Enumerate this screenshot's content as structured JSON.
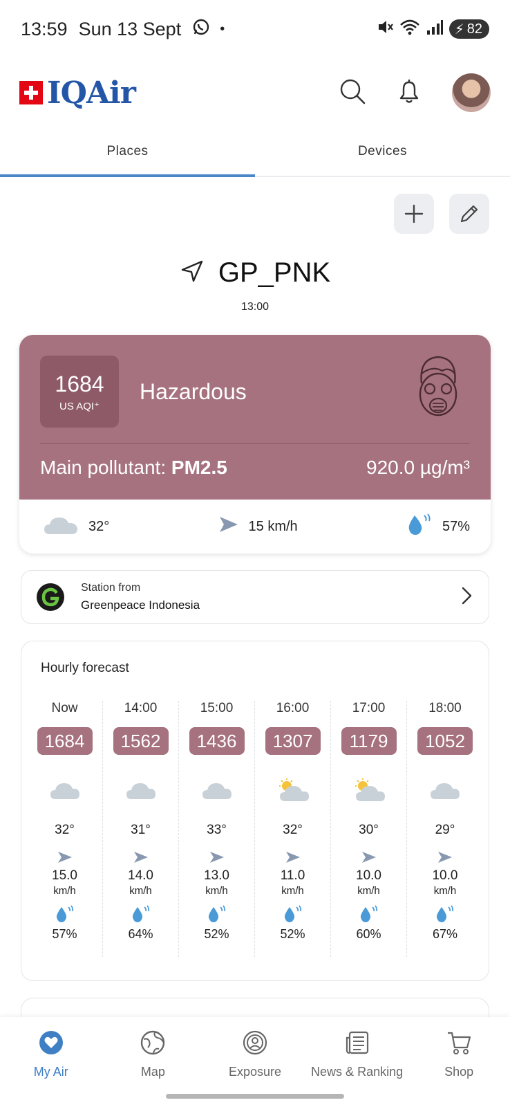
{
  "status_bar": {
    "time": "13:59",
    "date": "Sun 13 Sept",
    "battery": "82"
  },
  "header": {
    "brand": "IQAir"
  },
  "tabs": [
    {
      "label": "Places"
    },
    {
      "label": "Devices"
    }
  ],
  "location": {
    "name": "GP_PNK",
    "time": "13:00"
  },
  "aqi": {
    "value": "1684",
    "unit": "US AQI⁺",
    "level": "Hazardous",
    "main_pollutant_label": "Main pollutant: ",
    "main_pollutant": "PM2.5",
    "concentration": "920.0 µg/m³",
    "temperature": "32°",
    "wind": "15 km/h",
    "humidity": "57%",
    "color": "#a6727f"
  },
  "station": {
    "label": "Station from",
    "org": "Greenpeace Indonesia"
  },
  "hourly": {
    "title": "Hourly forecast",
    "items": [
      {
        "time": "Now",
        "aqi": "1684",
        "weather": "cloudy",
        "temp": "32°",
        "wind": "15.0",
        "unit": "km/h",
        "humidity": "57%"
      },
      {
        "time": "14:00",
        "aqi": "1562",
        "weather": "cloudy",
        "temp": "31°",
        "wind": "14.0",
        "unit": "km/h",
        "humidity": "64%"
      },
      {
        "time": "15:00",
        "aqi": "1436",
        "weather": "cloudy",
        "temp": "33°",
        "wind": "13.0",
        "unit": "km/h",
        "humidity": "52%"
      },
      {
        "time": "16:00",
        "aqi": "1307",
        "weather": "partly-sunny",
        "temp": "32°",
        "wind": "11.0",
        "unit": "km/h",
        "humidity": "52%"
      },
      {
        "time": "17:00",
        "aqi": "1179",
        "weather": "partly-sunny",
        "temp": "30°",
        "wind": "10.0",
        "unit": "km/h",
        "humidity": "60%"
      },
      {
        "time": "18:00",
        "aqi": "1052",
        "weather": "cloudy",
        "temp": "29°",
        "wind": "10.0",
        "unit": "km/h",
        "humidity": "67%"
      }
    ]
  },
  "nav": [
    {
      "label": "My Air",
      "icon": "heart-icon"
    },
    {
      "label": "Map",
      "icon": "globe-icon"
    },
    {
      "label": "Exposure",
      "icon": "exposure-icon"
    },
    {
      "label": "News & Ranking",
      "icon": "news-icon"
    },
    {
      "label": "Shop",
      "icon": "cart-icon"
    }
  ]
}
